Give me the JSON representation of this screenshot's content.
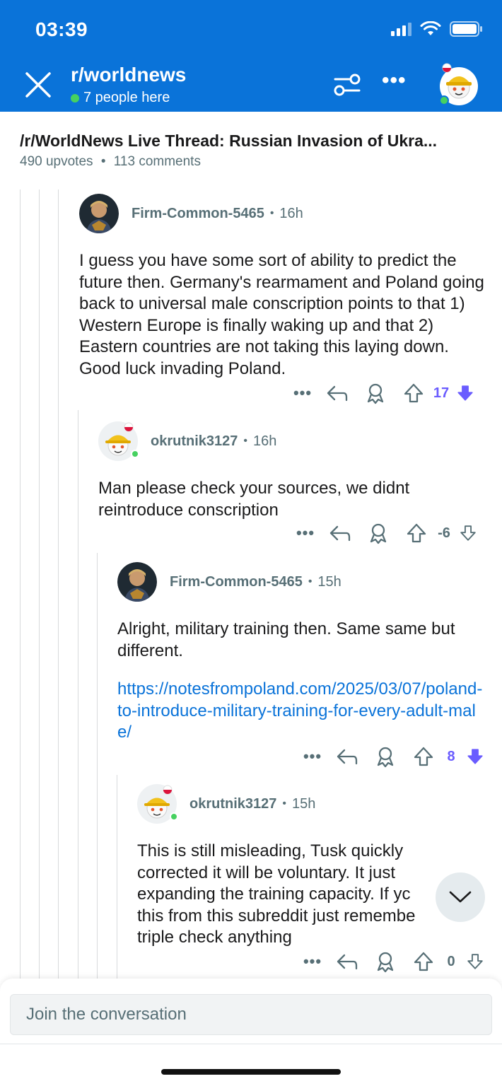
{
  "status_bar": {
    "time": "03:39"
  },
  "header": {
    "subreddit": "r/worldnews",
    "online": "7 people here",
    "more": "•••"
  },
  "post": {
    "title": "/r/WorldNews Live Thread: Russian Invasion of Ukra...",
    "upvotes": "490 upvotes",
    "comments": "113 comments",
    "separator": "•"
  },
  "comments": [
    {
      "user": "Firm-Common-5465",
      "time": "16h",
      "body": "I guess you have some sort of ability to predict the future then. Germany's rearmament and Poland going back to universal male conscription points to that 1) Western Europe is finally waking up and that 2) Eastern countries are not taking this laying down. Good luck invading Poland.",
      "votes": "17",
      "downvoted": true
    },
    {
      "user": "okrutnik3127",
      "time": "16h",
      "body": "Man please check your sources, we didnt reintroduce conscription",
      "votes": "-6",
      "downvoted": false
    },
    {
      "user": "Firm-Common-5465",
      "time": "15h",
      "body": "Alright, military training then. Same same but different.",
      "link": "https://notesfrompoland.com/2025/03/07/poland-to-introduce-military-training-for-every-adult-male/",
      "votes": "8",
      "downvoted": true
    },
    {
      "user": "okrutnik3127",
      "time": "15h",
      "body": "This is still misleading, Tusk quickly corrected it will be voluntary. It just expanding the training capacity. If yc this from this subreddit just remembe triple check anything",
      "votes": "0",
      "downvoted": false
    }
  ],
  "actions": {
    "more": "•••"
  },
  "composer": {
    "placeholder": "Join the conversation"
  },
  "colors": {
    "header_bg": "#0a73d9",
    "link": "#0a73d9",
    "downvote": "#6a5cff",
    "online": "#46d160"
  }
}
